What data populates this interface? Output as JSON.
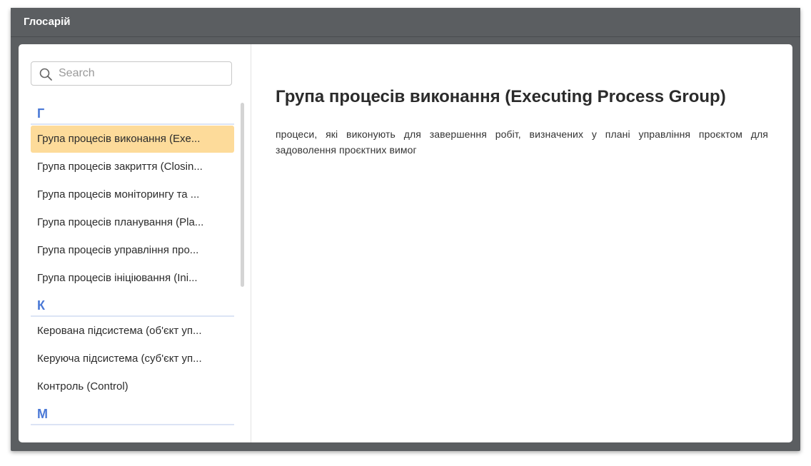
{
  "window": {
    "title": "Глосарій"
  },
  "search": {
    "placeholder": "Search",
    "value": ""
  },
  "groups": [
    {
      "letter": "Г",
      "items": [
        "Група процесів виконання (Exe...",
        "Група процесів закриття (Closin...",
        "Група процесів моніторингу та ...",
        "Група процесів планування (Pla...",
        "Група процесів управління про...",
        "Група процесів ініціювання (Ini..."
      ]
    },
    {
      "letter": "К",
      "items": [
        "Керована підсистема (об'єкт уп...",
        "Керуюча підсистема (суб'єкт уп...",
        "Контроль (Control)"
      ]
    },
    {
      "letter": "М",
      "items": []
    }
  ],
  "selected_item": "Група процесів виконання (Exe...",
  "detail": {
    "title": "Група процесів виконання (Executing Process Group)",
    "definition": "процеси, які виконують для завершення робіт, визначених у плані управління проєктом для задоволення проєктних вимог"
  },
  "colors": {
    "titlebar": "#5b5e61",
    "selected": "#fddb9a",
    "group_letter": "#4a78d6"
  },
  "icons": {
    "search": "search-icon"
  }
}
